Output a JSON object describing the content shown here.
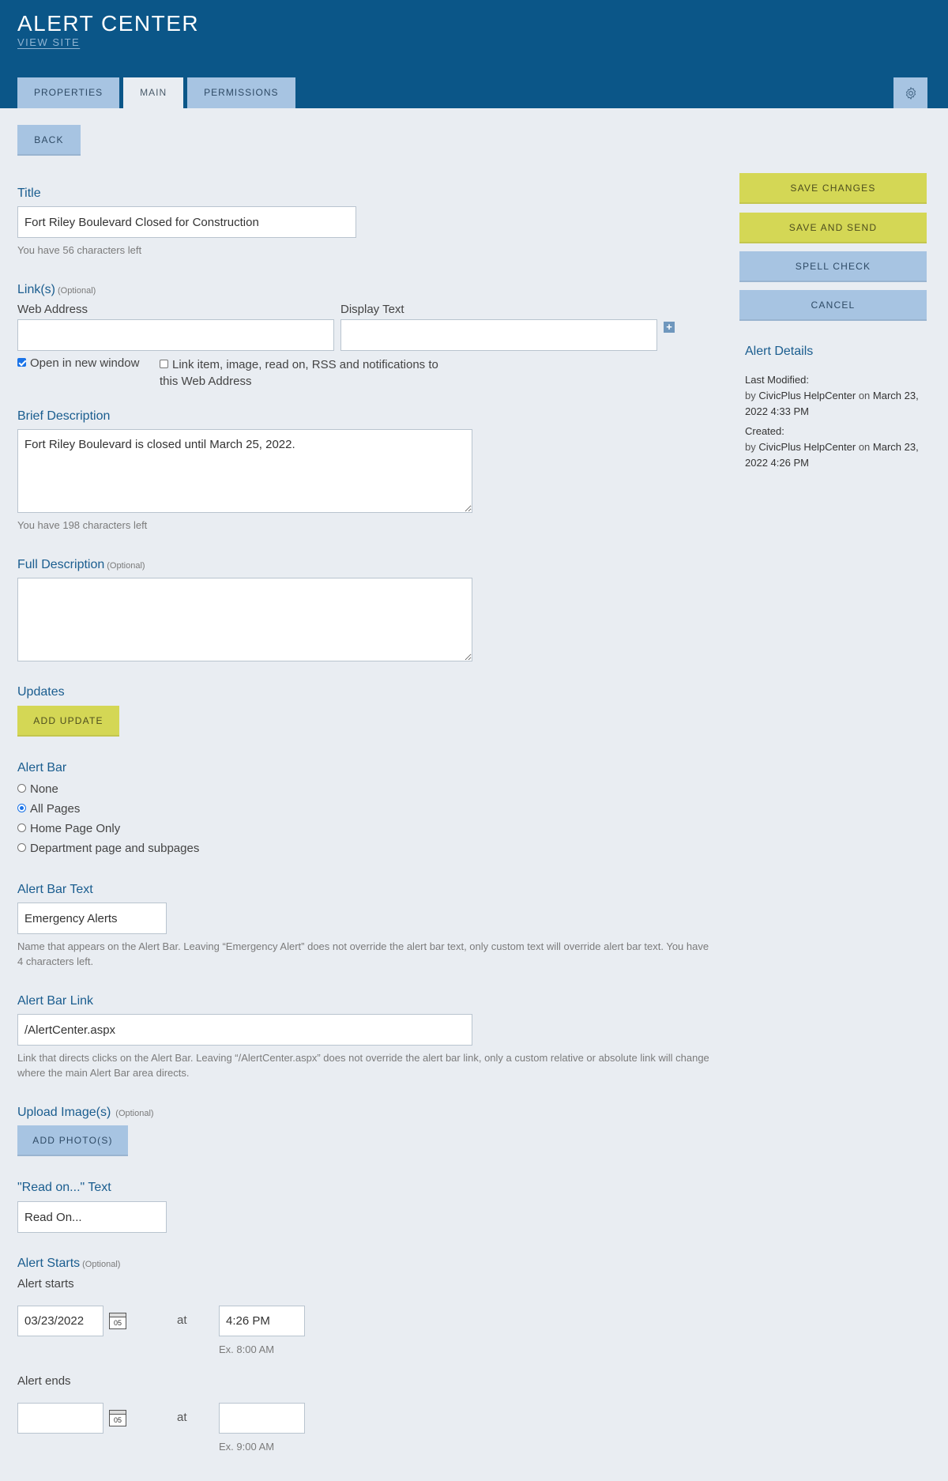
{
  "header": {
    "title": "ALERT CENTER",
    "view_site": "VIEW SITE",
    "tabs": [
      {
        "label": "PROPERTIES"
      },
      {
        "label": "MAIN"
      },
      {
        "label": "PERMISSIONS"
      }
    ],
    "active_tab": "MAIN",
    "settings_icon": "gear-icon"
  },
  "back_button": "BACK",
  "actions": {
    "save_changes": "SAVE CHANGES",
    "save_and_send": "SAVE AND SEND",
    "spell_check": "SPELL CHECK",
    "cancel": "CANCEL"
  },
  "alert_details": {
    "title": "Alert Details",
    "last_modified_label": "Last Modified:",
    "last_modified_by_prefix": "by",
    "last_modified_user": "CivicPlus HelpCenter",
    "last_modified_on": "on",
    "last_modified_date": "March 23, 2022 4:33 PM",
    "created_label": "Created:",
    "created_by_prefix": "by",
    "created_user": "CivicPlus HelpCenter",
    "created_on": "on",
    "created_date": "March 23, 2022 4:26 PM"
  },
  "form": {
    "title": {
      "label": "Title",
      "value": "Fort Riley Boulevard Closed for Construction",
      "help": "You have 56 characters left"
    },
    "links": {
      "label": "Link(s)",
      "optional": "(Optional)",
      "web_address_label": "Web Address",
      "web_address_value": "",
      "display_text_label": "Display Text",
      "display_text_value": "",
      "add_icon": "plus-icon",
      "open_new_window": {
        "label": "Open in new window",
        "checked": true
      },
      "link_item": {
        "label": "Link item, image, read on, RSS and notifications to this Web Address",
        "checked": false
      }
    },
    "brief_description": {
      "label": "Brief Description",
      "value": "Fort Riley Boulevard is closed until March 25, 2022.",
      "help": "You have 198 characters left"
    },
    "full_description": {
      "label": "Full Description",
      "optional": "(Optional)",
      "value": ""
    },
    "updates": {
      "label": "Updates",
      "button": "ADD UPDATE"
    },
    "alert_bar": {
      "label": "Alert Bar",
      "options": [
        {
          "label": "None",
          "checked": false
        },
        {
          "label": "All Pages",
          "checked": true
        },
        {
          "label": "Home Page Only",
          "checked": false
        },
        {
          "label": "Department page and subpages",
          "checked": false
        }
      ]
    },
    "alert_bar_text": {
      "label": "Alert Bar Text",
      "value": "Emergency Alerts",
      "help": "Name that appears on the Alert Bar. Leaving “Emergency Alert” does not override the alert bar text, only custom text will override alert bar text. You have 4 characters left."
    },
    "alert_bar_link": {
      "label": "Alert Bar Link",
      "value": "/AlertCenter.aspx",
      "help": "Link that directs clicks on the Alert Bar. Leaving “/AlertCenter.aspx” does not override the alert bar link, only a custom relative or absolute link will change where the main Alert Bar area directs."
    },
    "upload_images": {
      "label": "Upload Image(s)",
      "optional": "(Optional)",
      "button": "ADD PHOTO(S)"
    },
    "read_on": {
      "label": "\"Read on...\" Text",
      "value": "Read On..."
    },
    "alert_starts": {
      "label": "Alert Starts",
      "optional": "(Optional)",
      "starts_label": "Alert starts",
      "start_date": "03/23/2022",
      "calendar_day": "05",
      "at": "at",
      "start_time": "4:26 PM",
      "start_time_example": "Ex. 8:00 AM",
      "ends_label": "Alert ends",
      "end_date": "",
      "end_time": "",
      "end_time_example": "Ex. 9:00 AM"
    }
  }
}
